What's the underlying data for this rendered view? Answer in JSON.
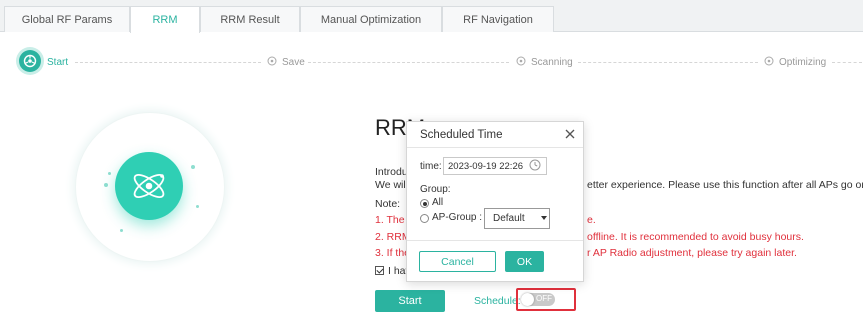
{
  "tabs": [
    {
      "label": "Global RF Params"
    },
    {
      "label": "RRM"
    },
    {
      "label": "RRM Result"
    },
    {
      "label": "Manual Optimization"
    },
    {
      "label": "RF Navigation"
    }
  ],
  "active_tab": "RRM",
  "steps": [
    {
      "label": "Start",
      "state": "active"
    },
    {
      "label": "Save",
      "state": "pending"
    },
    {
      "label": "Scanning",
      "state": "pending"
    },
    {
      "label": "Optimizing",
      "state": "pending"
    }
  ],
  "main": {
    "title": "RRM",
    "intro_label": "Introdu",
    "intro_line": "We will",
    "intro_tail": "etter experience. Please use this function after all APs go online.",
    "note_label": "Note:",
    "note1_head": "1. The s",
    "note1_tail": "e.",
    "note2_head": "2. RRM",
    "note2_tail": "offline. It is recommended to avoid busy hours.",
    "note3_head": "3. If the",
    "note3_tail": "r AP Radio adjustment, please try again later.",
    "checkbox_label": "I have",
    "start_button": "Start",
    "schedule_label": "Schedule:",
    "schedule_toggle": "OFF"
  },
  "modal": {
    "title": "Scheduled Time",
    "time_label": "time:",
    "time_value": "2023-09-19 22:26",
    "group_label": "Group:",
    "option_all": "All",
    "option_ap_group": "AP-Group :",
    "ap_group_select": "Default",
    "cancel": "Cancel",
    "ok": "OK"
  },
  "colors": {
    "accent": "#2bb3a0",
    "warning": "#e0303c"
  },
  "icons": [
    "start-step-icon",
    "save-step-icon",
    "scanning-step-icon",
    "optimizing-step-icon",
    "atom-icon",
    "close-icon",
    "clock-icon",
    "chevron-down-icon"
  ]
}
